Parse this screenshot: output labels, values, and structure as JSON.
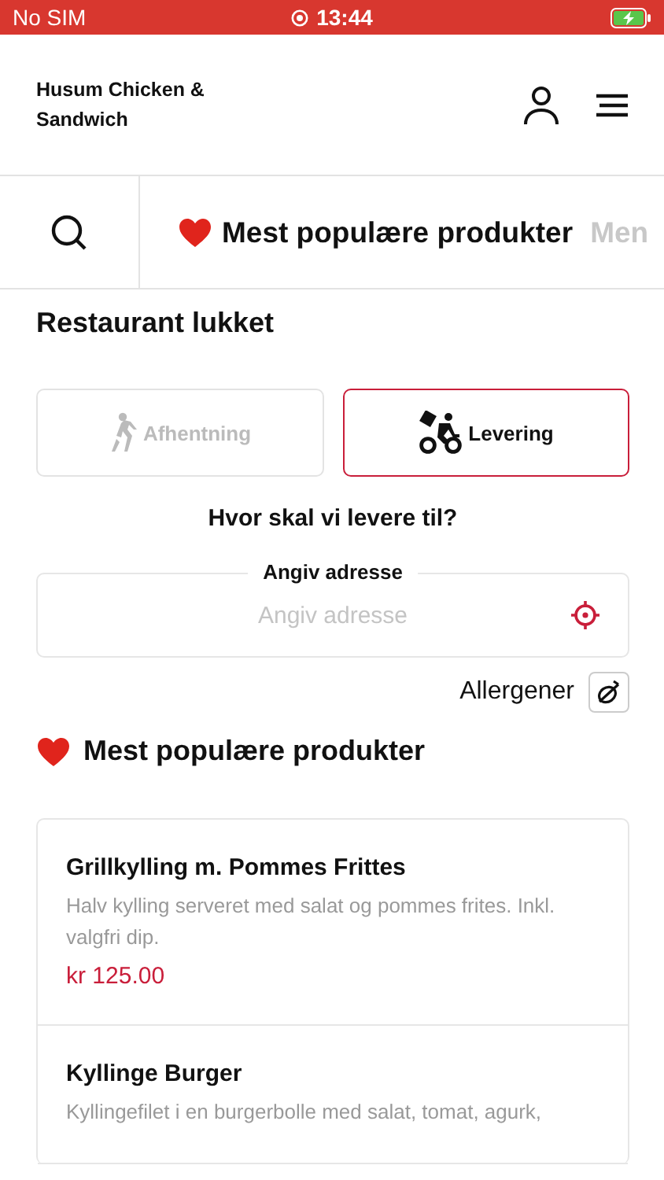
{
  "status_bar": {
    "carrier": "No SIM",
    "time": "13:44"
  },
  "header": {
    "title": "Husum Chicken & Sandwich"
  },
  "category_tabs": [
    {
      "kind": "heart",
      "label": "Mest populære produkter",
      "selected": true
    },
    {
      "kind": "plain",
      "label": "Men",
      "selected": false
    }
  ],
  "status_heading": "Restaurant lukket",
  "order_modes": [
    {
      "kind": "walk",
      "label": "Afhentning",
      "selected": false
    },
    {
      "kind": "bike",
      "label": "Levering",
      "selected": true
    }
  ],
  "delivery_question": "Hvor skal vi levere til?",
  "address_field": {
    "label": "Angiv adresse",
    "placeholder": "Angiv adresse"
  },
  "allergens": {
    "label": "Allergener"
  },
  "section": {
    "title": "Mest populære produkter"
  },
  "products": [
    {
      "name": "Grillkylling m. Pommes Frittes",
      "description": "Halv kylling serveret med salat og pommes frites. Inkl. valgfri dip.",
      "price": "kr 125.00"
    },
    {
      "name": "Kyllinge Burger",
      "description": "Kyllingefilet i en burgerbolle med salat, tomat, agurk,"
    }
  ]
}
